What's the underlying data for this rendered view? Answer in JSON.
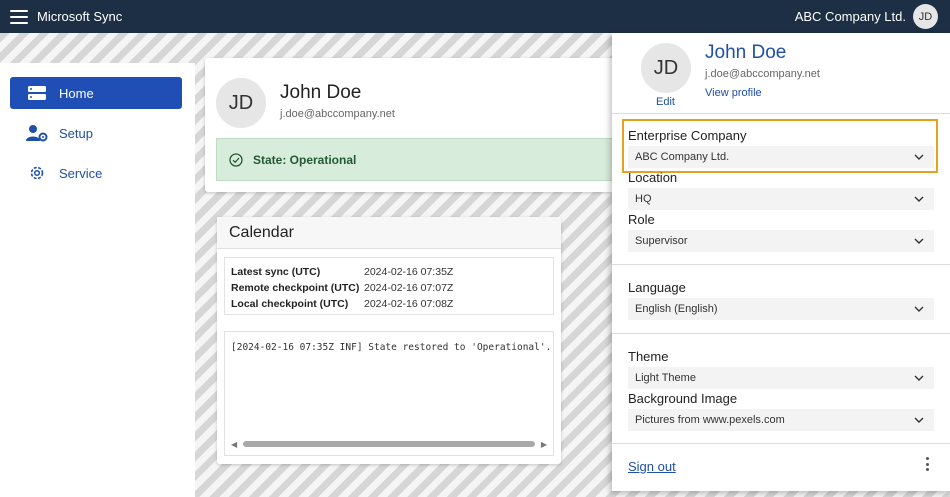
{
  "topbar": {
    "app_title": "Microsoft Sync",
    "company": "ABC Company Ltd.",
    "avatar_initials": "JD"
  },
  "sidebar": {
    "items": [
      {
        "label": "Home",
        "icon": "server-icon",
        "active": true
      },
      {
        "label": "Setup",
        "icon": "users-gear-icon",
        "active": false
      },
      {
        "label": "Service",
        "icon": "gear-icon",
        "active": false
      }
    ]
  },
  "profile_card": {
    "initials": "JD",
    "name": "John Doe",
    "email": "j.doe@abccompany.net",
    "state": "State: Operational"
  },
  "calendar": {
    "title": "Calendar",
    "rows": [
      {
        "label": "Latest sync (UTC)",
        "value": "2024-02-16 07:35Z"
      },
      {
        "label": "Remote checkpoint (UTC)",
        "value": "2024-02-16 07:07Z"
      },
      {
        "label": "Local checkpoint (UTC)",
        "value": "2024-02-16 07:08Z"
      }
    ],
    "log": "[2024-02-16 07:35Z INF] State restored to 'Operational'."
  },
  "panel": {
    "initials": "JD",
    "edit": "Edit",
    "name": "John Doe",
    "email": "j.doe@abccompany.net",
    "view_profile": "View profile",
    "enterprise_label": "Enterprise Company",
    "enterprise_value": "ABC Company Ltd.",
    "location_label": "Location",
    "location_value": "HQ",
    "role_label": "Role",
    "role_value": "Supervisor",
    "language_label": "Language",
    "language_value": "English (English)",
    "theme_label": "Theme",
    "theme_value": "Light Theme",
    "bgimage_label": "Background Image",
    "bgimage_value": "Pictures from www.pexels.com",
    "sign_out": "Sign out"
  },
  "colors": {
    "topbar": "#1d2f45",
    "accent": "#1f4fb5",
    "highlight": "#e6a11f",
    "state_bg": "#d8ecdc"
  }
}
